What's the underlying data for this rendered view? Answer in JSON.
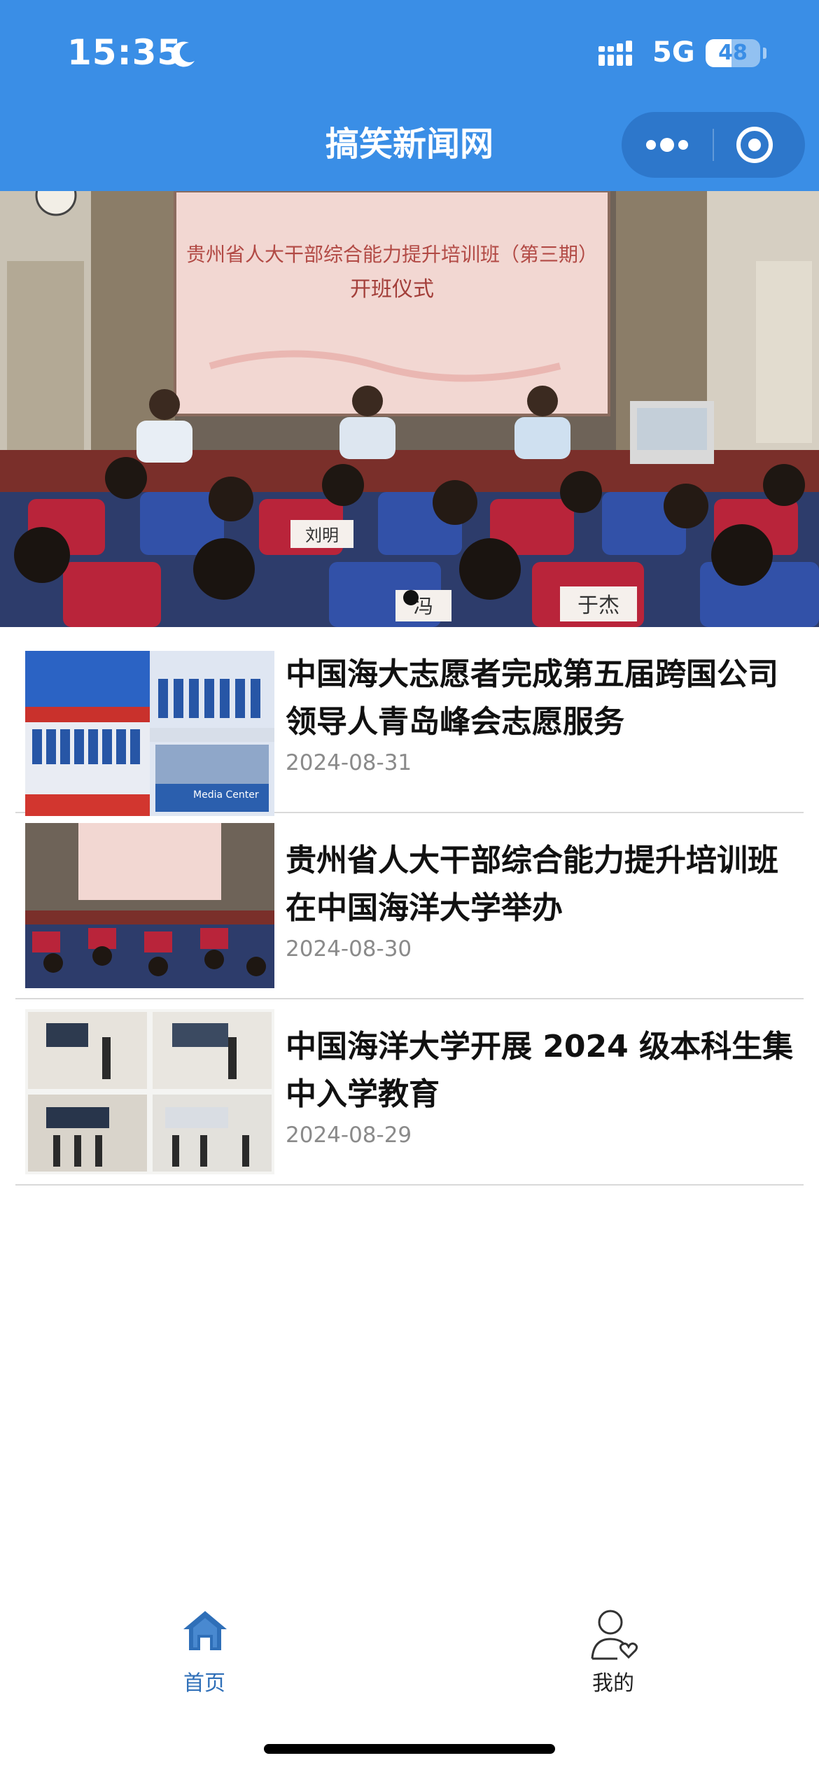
{
  "status_bar": {
    "time": "15:35",
    "network": "5G",
    "battery": "48",
    "battery_level": 0.48
  },
  "header": {
    "title": "搞笑新闻网"
  },
  "capsule": {
    "more_icon": "more-dots-icon",
    "close_icon": "target-close-icon"
  },
  "banner": {
    "screen_title": "贵州省人大干部综合能力提升培训班（第三期）",
    "screen_subtitle": "开班仪式",
    "nameplates": [
      "于杰",
      "冯",
      "刘明"
    ],
    "active_index": 0,
    "count": 1
  },
  "news": [
    {
      "title": "中国海大志愿者完成第五届跨国公司领导人青岛峰会志愿服务",
      "date": "2024-08-31",
      "thumb_caption": "Media Center"
    },
    {
      "title": "贵州省人大干部综合能力提升培训班在中国海洋大学举办",
      "date": "2024-08-30"
    },
    {
      "title": "中国海洋大学开展 2024 级本科生集中入学教育",
      "date": "2024-08-29"
    }
  ],
  "tabbar": {
    "items": [
      {
        "label": "首页",
        "icon": "home-icon",
        "active": true
      },
      {
        "label": "我的",
        "icon": "user-heart-icon",
        "active": false
      }
    ],
    "active_color": "#2f6fb8"
  },
  "colors": {
    "header_bg": "#3a8ee6",
    "text": "#111111",
    "date": "#8a8a8a"
  }
}
